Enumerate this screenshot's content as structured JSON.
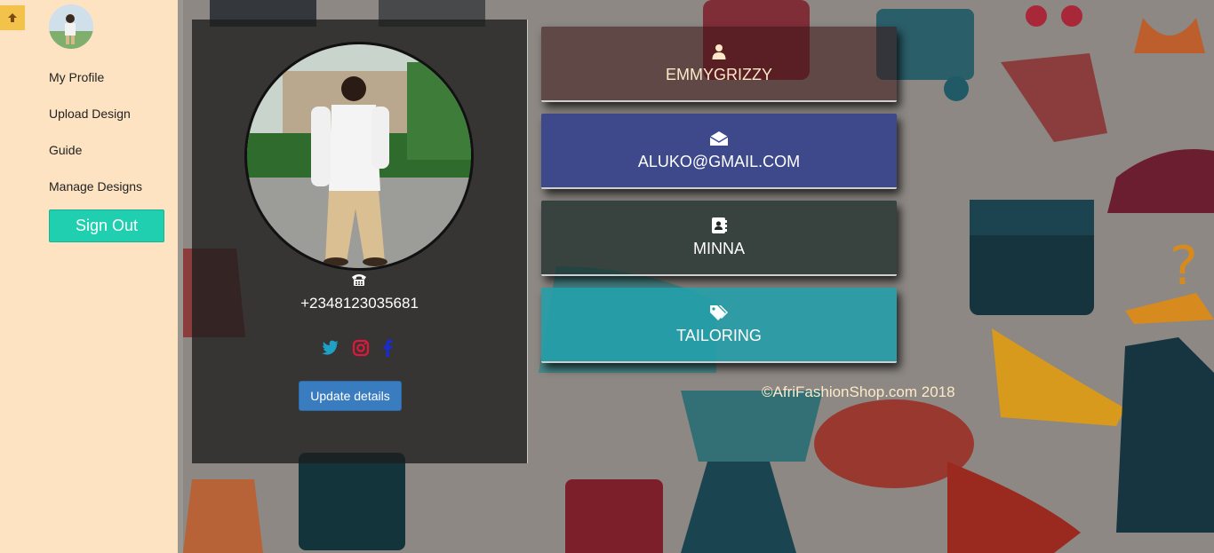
{
  "sidebar": {
    "nav": [
      "My Profile",
      "Upload Design",
      "Guide",
      "Manage Designs"
    ],
    "signout_label": "Sign Out"
  },
  "profile": {
    "phone": "+2348123035681",
    "update_label": "Update details",
    "social_icons": [
      "twitter-icon",
      "instagram-icon",
      "facebook-icon"
    ]
  },
  "cards": {
    "username": "EMMYGRIZZY",
    "email": "ALUKO@GMAIL.COM",
    "city": "MINNA",
    "trade": "TAILORING"
  },
  "footer": {
    "copyright": "©AfriFashionShop.com 2018"
  },
  "colors": {
    "sidebar_bg": "#fde3c1",
    "accent_teal": "#1fcfb0",
    "button_blue": "#3a7cc0"
  }
}
